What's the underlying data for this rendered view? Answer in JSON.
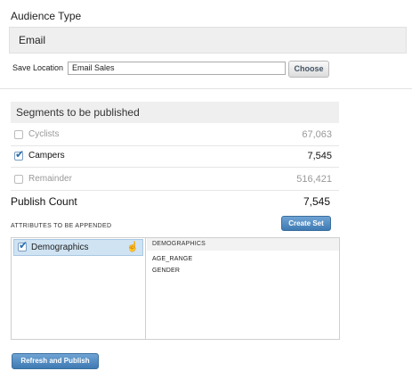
{
  "audience": {
    "title": "Audience Type",
    "type_value": "Email",
    "save_location_label": "Save Location",
    "save_location_value": "Email Sales",
    "choose_label": "Choose"
  },
  "segments": {
    "header": "Segments to be published",
    "rows": [
      {
        "name": "Cyclists",
        "count": "67,063",
        "checked": false
      },
      {
        "name": "Campers",
        "count": "7,545",
        "checked": true
      },
      {
        "name": "Remainder",
        "count": "516,421",
        "checked": false
      }
    ],
    "publish_count_label": "Publish Count",
    "publish_count_value": "7,545"
  },
  "attributes": {
    "title": "ATTRIBUTES TO BE APPENDED",
    "create_set_label": "Create Set",
    "groups": [
      {
        "name": "Demographics",
        "checked": true
      }
    ],
    "detail_header": "DEMOGRAPHICS",
    "detail_items": [
      "AGE_RANGE",
      "GENDER"
    ]
  },
  "actions": {
    "refresh_publish_label": "Refresh and Publish"
  },
  "colors": {
    "accent_blue": "#3e7ab3",
    "selected_row": "#cfe3f3",
    "panel_gray": "#efefef"
  },
  "icons": {
    "check": "check-icon",
    "cursor": "hand-pointer-icon"
  }
}
